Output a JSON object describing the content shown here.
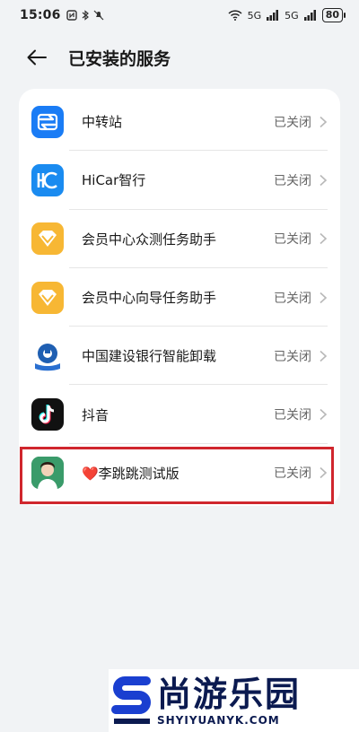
{
  "statusbar": {
    "time": "15:06",
    "battery": "80",
    "signal_label": "5G"
  },
  "header": {
    "title": "已安装的服务"
  },
  "services": [
    {
      "name": "中转站",
      "status": "已关闭",
      "icon": "transfer-station-icon",
      "color": "#1a7cf5"
    },
    {
      "name": "HiCar智行",
      "status": "已关闭",
      "icon": "hicar-icon",
      "color": "#1a8bf0"
    },
    {
      "name": "会员中心众测任务助手",
      "status": "已关闭",
      "icon": "member-diamond-icon",
      "color": "#f7b734"
    },
    {
      "name": "会员中心向导任务助手",
      "status": "已关闭",
      "icon": "member-diamond-icon",
      "color": "#f7b734"
    },
    {
      "name": "中国建设银行智能卸载",
      "status": "已关闭",
      "icon": "ccb-bank-icon",
      "color": "#1f5fb2"
    },
    {
      "name": "抖音",
      "status": "已关闭",
      "icon": "douyin-icon",
      "color": "#111111"
    },
    {
      "name": "❤️李跳跳测试版",
      "status": "已关闭",
      "icon": "li-tiaotiao-icon",
      "color": "#2f8a5a"
    }
  ],
  "watermark": {
    "cn": "尚游乐园",
    "en": "SHYIYUANYK.COM"
  },
  "highlight_color": "#d0262d"
}
